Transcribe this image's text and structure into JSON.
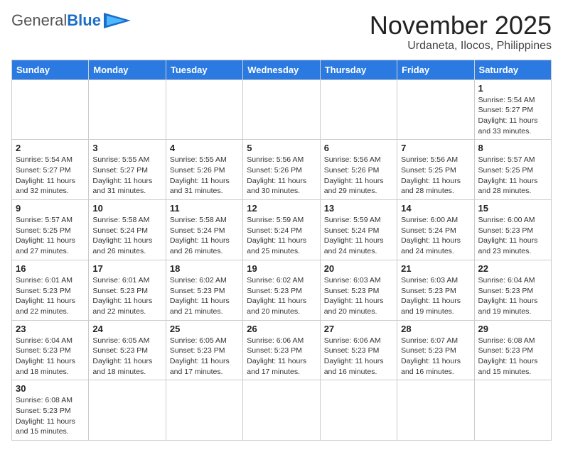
{
  "header": {
    "logo_general": "General",
    "logo_blue": "Blue",
    "month": "November 2025",
    "location": "Urdaneta, Ilocos, Philippines"
  },
  "weekdays": [
    "Sunday",
    "Monday",
    "Tuesday",
    "Wednesday",
    "Thursday",
    "Friday",
    "Saturday"
  ],
  "weeks": [
    [
      {
        "day": "",
        "content": ""
      },
      {
        "day": "",
        "content": ""
      },
      {
        "day": "",
        "content": ""
      },
      {
        "day": "",
        "content": ""
      },
      {
        "day": "",
        "content": ""
      },
      {
        "day": "",
        "content": ""
      },
      {
        "day": "1",
        "content": "Sunrise: 5:54 AM\nSunset: 5:27 PM\nDaylight: 11 hours\nand 33 minutes."
      }
    ],
    [
      {
        "day": "2",
        "content": "Sunrise: 5:54 AM\nSunset: 5:27 PM\nDaylight: 11 hours\nand 32 minutes."
      },
      {
        "day": "3",
        "content": "Sunrise: 5:55 AM\nSunset: 5:27 PM\nDaylight: 11 hours\nand 31 minutes."
      },
      {
        "day": "4",
        "content": "Sunrise: 5:55 AM\nSunset: 5:26 PM\nDaylight: 11 hours\nand 31 minutes."
      },
      {
        "day": "5",
        "content": "Sunrise: 5:56 AM\nSunset: 5:26 PM\nDaylight: 11 hours\nand 30 minutes."
      },
      {
        "day": "6",
        "content": "Sunrise: 5:56 AM\nSunset: 5:26 PM\nDaylight: 11 hours\nand 29 minutes."
      },
      {
        "day": "7",
        "content": "Sunrise: 5:56 AM\nSunset: 5:25 PM\nDaylight: 11 hours\nand 28 minutes."
      },
      {
        "day": "8",
        "content": "Sunrise: 5:57 AM\nSunset: 5:25 PM\nDaylight: 11 hours\nand 28 minutes."
      }
    ],
    [
      {
        "day": "9",
        "content": "Sunrise: 5:57 AM\nSunset: 5:25 PM\nDaylight: 11 hours\nand 27 minutes."
      },
      {
        "day": "10",
        "content": "Sunrise: 5:58 AM\nSunset: 5:24 PM\nDaylight: 11 hours\nand 26 minutes."
      },
      {
        "day": "11",
        "content": "Sunrise: 5:58 AM\nSunset: 5:24 PM\nDaylight: 11 hours\nand 26 minutes."
      },
      {
        "day": "12",
        "content": "Sunrise: 5:59 AM\nSunset: 5:24 PM\nDaylight: 11 hours\nand 25 minutes."
      },
      {
        "day": "13",
        "content": "Sunrise: 5:59 AM\nSunset: 5:24 PM\nDaylight: 11 hours\nand 24 minutes."
      },
      {
        "day": "14",
        "content": "Sunrise: 6:00 AM\nSunset: 5:24 PM\nDaylight: 11 hours\nand 24 minutes."
      },
      {
        "day": "15",
        "content": "Sunrise: 6:00 AM\nSunset: 5:23 PM\nDaylight: 11 hours\nand 23 minutes."
      }
    ],
    [
      {
        "day": "16",
        "content": "Sunrise: 6:01 AM\nSunset: 5:23 PM\nDaylight: 11 hours\nand 22 minutes."
      },
      {
        "day": "17",
        "content": "Sunrise: 6:01 AM\nSunset: 5:23 PM\nDaylight: 11 hours\nand 22 minutes."
      },
      {
        "day": "18",
        "content": "Sunrise: 6:02 AM\nSunset: 5:23 PM\nDaylight: 11 hours\nand 21 minutes."
      },
      {
        "day": "19",
        "content": "Sunrise: 6:02 AM\nSunset: 5:23 PM\nDaylight: 11 hours\nand 20 minutes."
      },
      {
        "day": "20",
        "content": "Sunrise: 6:03 AM\nSunset: 5:23 PM\nDaylight: 11 hours\nand 20 minutes."
      },
      {
        "day": "21",
        "content": "Sunrise: 6:03 AM\nSunset: 5:23 PM\nDaylight: 11 hours\nand 19 minutes."
      },
      {
        "day": "22",
        "content": "Sunrise: 6:04 AM\nSunset: 5:23 PM\nDaylight: 11 hours\nand 19 minutes."
      }
    ],
    [
      {
        "day": "23",
        "content": "Sunrise: 6:04 AM\nSunset: 5:23 PM\nDaylight: 11 hours\nand 18 minutes."
      },
      {
        "day": "24",
        "content": "Sunrise: 6:05 AM\nSunset: 5:23 PM\nDaylight: 11 hours\nand 18 minutes."
      },
      {
        "day": "25",
        "content": "Sunrise: 6:05 AM\nSunset: 5:23 PM\nDaylight: 11 hours\nand 17 minutes."
      },
      {
        "day": "26",
        "content": "Sunrise: 6:06 AM\nSunset: 5:23 PM\nDaylight: 11 hours\nand 17 minutes."
      },
      {
        "day": "27",
        "content": "Sunrise: 6:06 AM\nSunset: 5:23 PM\nDaylight: 11 hours\nand 16 minutes."
      },
      {
        "day": "28",
        "content": "Sunrise: 6:07 AM\nSunset: 5:23 PM\nDaylight: 11 hours\nand 16 minutes."
      },
      {
        "day": "29",
        "content": "Sunrise: 6:08 AM\nSunset: 5:23 PM\nDaylight: 11 hours\nand 15 minutes."
      }
    ],
    [
      {
        "day": "30",
        "content": "Sunrise: 6:08 AM\nSunset: 5:23 PM\nDaylight: 11 hours\nand 15 minutes."
      },
      {
        "day": "",
        "content": ""
      },
      {
        "day": "",
        "content": ""
      },
      {
        "day": "",
        "content": ""
      },
      {
        "day": "",
        "content": ""
      },
      {
        "day": "",
        "content": ""
      },
      {
        "day": "",
        "content": ""
      }
    ]
  ]
}
